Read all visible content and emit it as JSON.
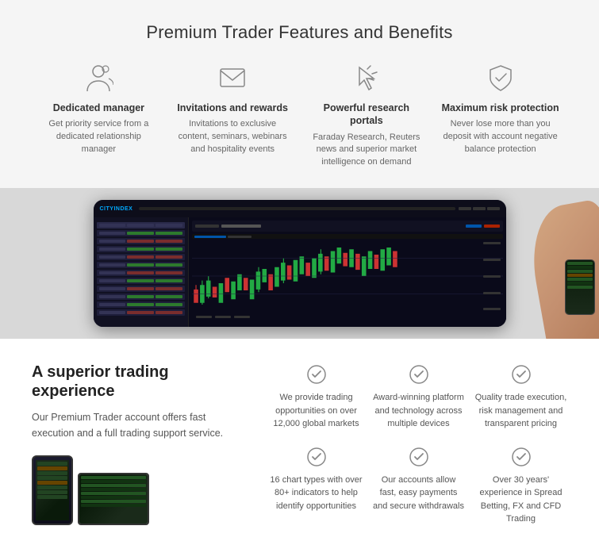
{
  "page": {
    "premium_title": "Premium Trader Features and Benefits",
    "features": [
      {
        "id": "dedicated-manager",
        "icon": "person",
        "title": "Dedicated manager",
        "desc": "Get priority service from a dedicated relationship manager"
      },
      {
        "id": "invitations-rewards",
        "icon": "mail",
        "title": "Invitations and rewards",
        "desc": "Invitations to exclusive content, seminars, webinars and hospitality events"
      },
      {
        "id": "research-portals",
        "icon": "cursor",
        "title": "Powerful research portals",
        "desc": "Faraday Research, Reuters news and superior market intelligence on demand"
      },
      {
        "id": "risk-protection",
        "icon": "shield",
        "title": "Maximum risk protection",
        "desc": "Never lose more than you deposit with account negative balance protection"
      }
    ],
    "trading": {
      "title": "A superior trading experience",
      "desc": "Our Premium Trader account offers fast execution and a full trading support service.",
      "benefits": [
        {
          "text": "We provide trading opportunities on over 12,000 global markets"
        },
        {
          "text": "Award-winning platform and technology across multiple devices"
        },
        {
          "text": "Quality trade execution, risk management and transparent pricing"
        },
        {
          "text": "16 chart types with over 80+ indicators to help identify opportunities"
        },
        {
          "text": "Our accounts allow fast, easy payments and secure withdrawals"
        },
        {
          "text": "Over 30 years' experience in Spread Betting, FX and CFD Trading"
        }
      ]
    }
  }
}
